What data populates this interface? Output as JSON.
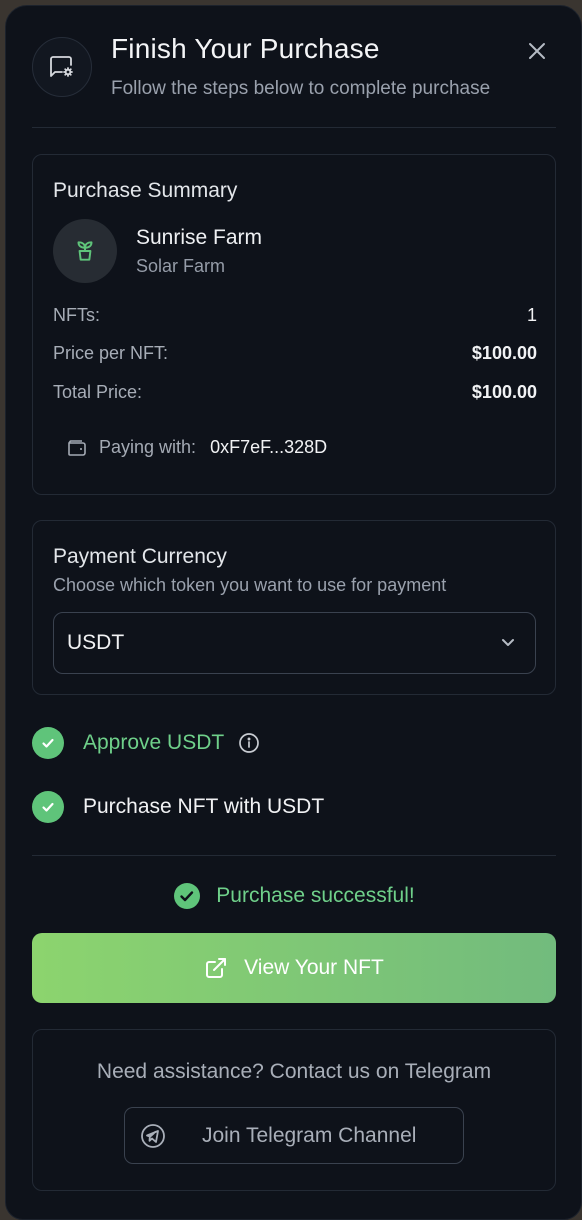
{
  "header": {
    "title": "Finish Your Purchase",
    "subtitle": "Follow the steps below to complete purchase"
  },
  "summary": {
    "title": "Purchase Summary",
    "farm_name": "Sunrise Farm",
    "farm_type": "Solar Farm",
    "rows": [
      {
        "label": "NFTs:",
        "value": "1"
      },
      {
        "label": "Price per NFT:",
        "value": "$100.00"
      },
      {
        "label": "Total Price:",
        "value": "$100.00"
      }
    ],
    "paying_label": "Paying with:",
    "paying_address": "0xF7eF...328D"
  },
  "currency": {
    "title": "Payment Currency",
    "subtitle": "Choose which token you want to use for payment",
    "selected": "USDT"
  },
  "steps": [
    {
      "label": "Approve USDT",
      "status": "complete"
    },
    {
      "label": "Purchase NFT with USDT",
      "status": "complete"
    }
  ],
  "success_message": "Purchase successful!",
  "view_button_label": "View Your NFT",
  "help": {
    "text": "Need assistance? Contact us on Telegram",
    "button_label": "Join Telegram Channel"
  },
  "colors": {
    "background": "#0e121a",
    "success_green": "#5fc47a",
    "button_gradient_start": "#8cd46e",
    "button_gradient_end": "#72bb7d"
  },
  "icons": {
    "header": "message-gear-icon",
    "close": "close-icon",
    "farm": "sprout-icon",
    "wallet": "wallet-icon",
    "dropdown": "chevron-down-icon",
    "check": "check-circle-icon",
    "info": "info-icon",
    "external": "external-link-icon",
    "telegram": "telegram-icon"
  }
}
